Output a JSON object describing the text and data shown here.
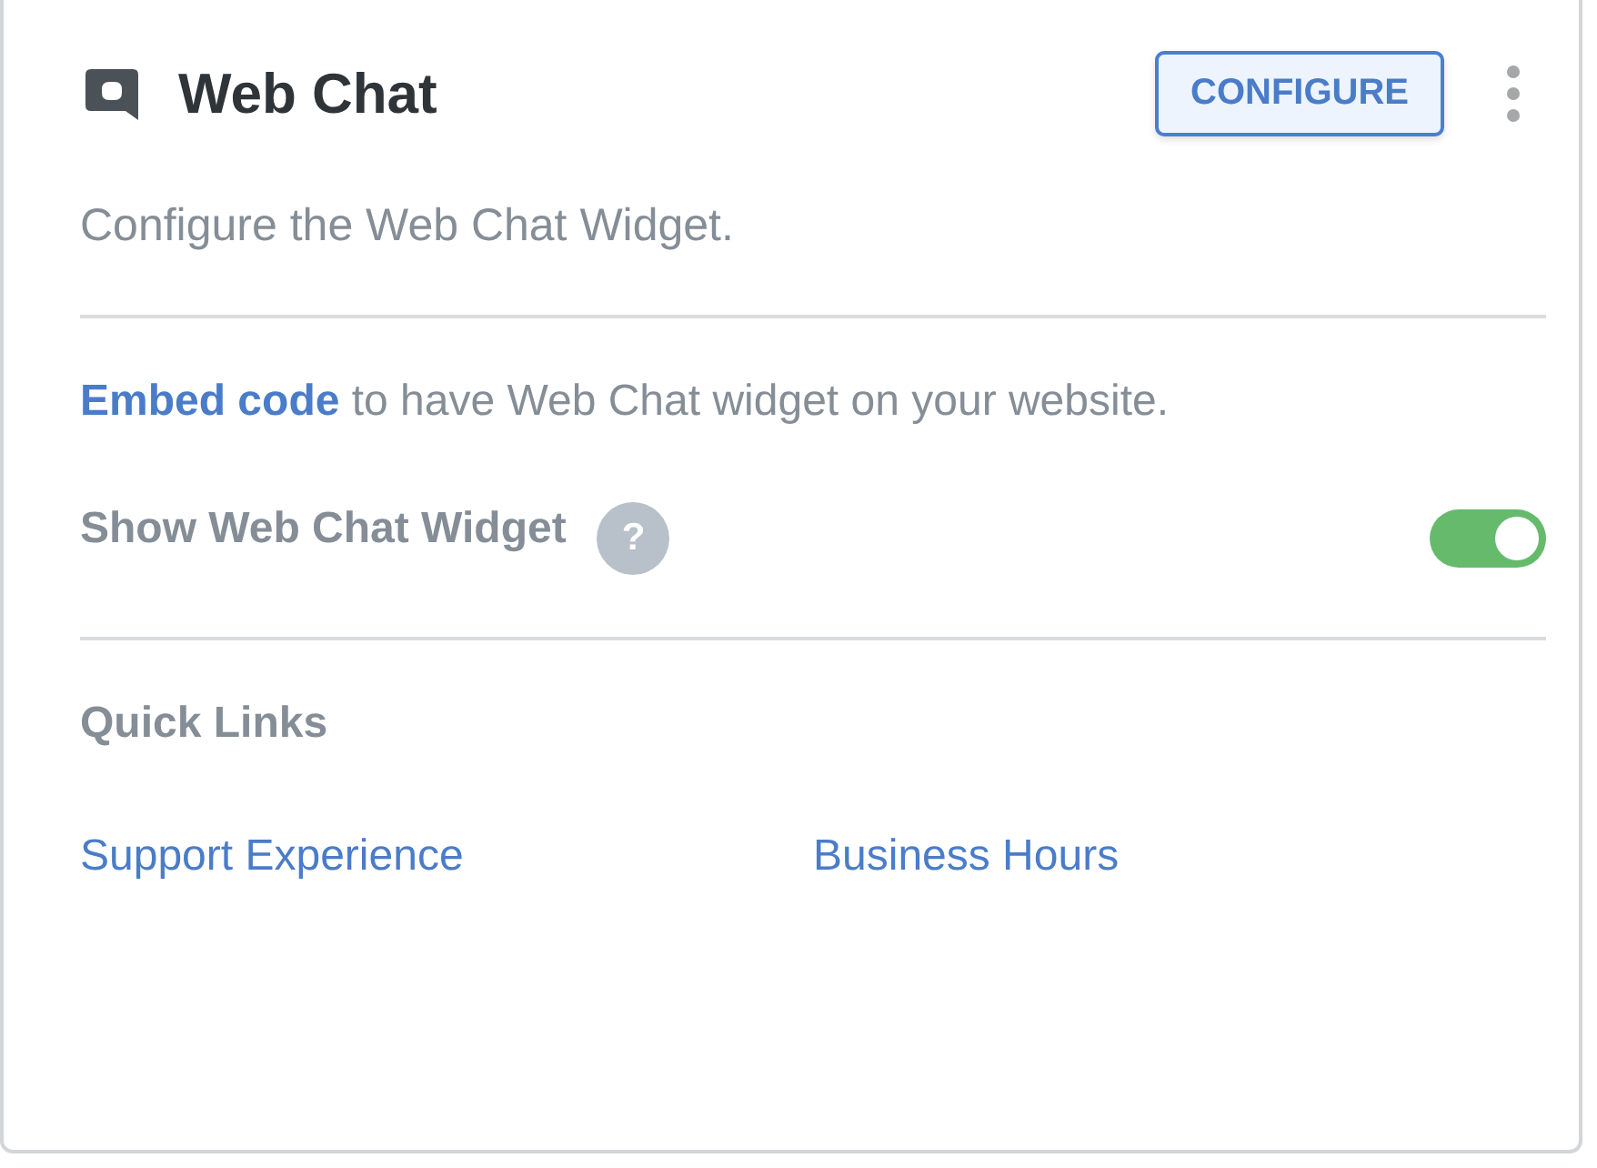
{
  "header": {
    "title": "Web Chat",
    "configure_button": "CONFIGURE"
  },
  "description": "Configure the Web Chat Widget.",
  "embed": {
    "link": "Embed code",
    "text": "to have Web Chat widget on your website."
  },
  "toggle_row": {
    "label": "Show Web Chat Widget",
    "help": "?",
    "on": true
  },
  "quick_links": {
    "title": "Quick Links",
    "links": [
      "Support Experience",
      "Business Hours"
    ]
  }
}
